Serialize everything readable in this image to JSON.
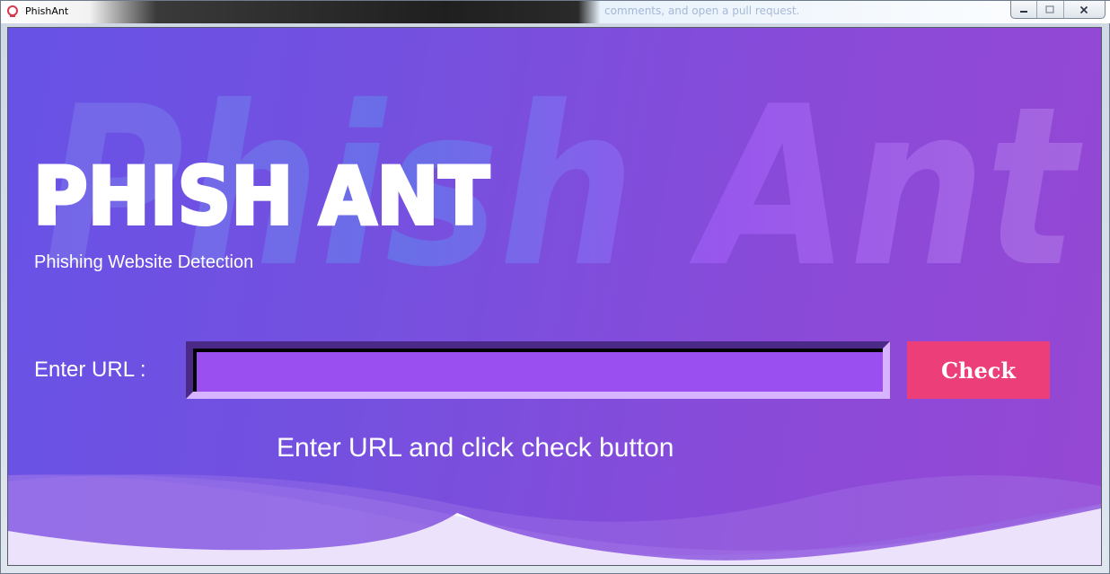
{
  "window": {
    "title": "PhishAnt",
    "background_captions": [
      "              ",
      "comments, and open a pull request."
    ]
  },
  "controls": {
    "minimize_icon": "minimize-icon",
    "maximize_icon": "maximize-icon",
    "close_icon": "close-icon"
  },
  "app": {
    "watermark": "Phish Ant",
    "logo": "PHISH ANT",
    "subtitle": "Phishing Website Detection",
    "url_label": "Enter URL :",
    "url_value": "",
    "check_label": "Check",
    "status": "Enter URL and click check button"
  },
  "colors": {
    "gradient_start": "#6752e6",
    "gradient_end": "#9548d3",
    "button": "#ec3f79",
    "input_fill": "#9a4ff0"
  }
}
